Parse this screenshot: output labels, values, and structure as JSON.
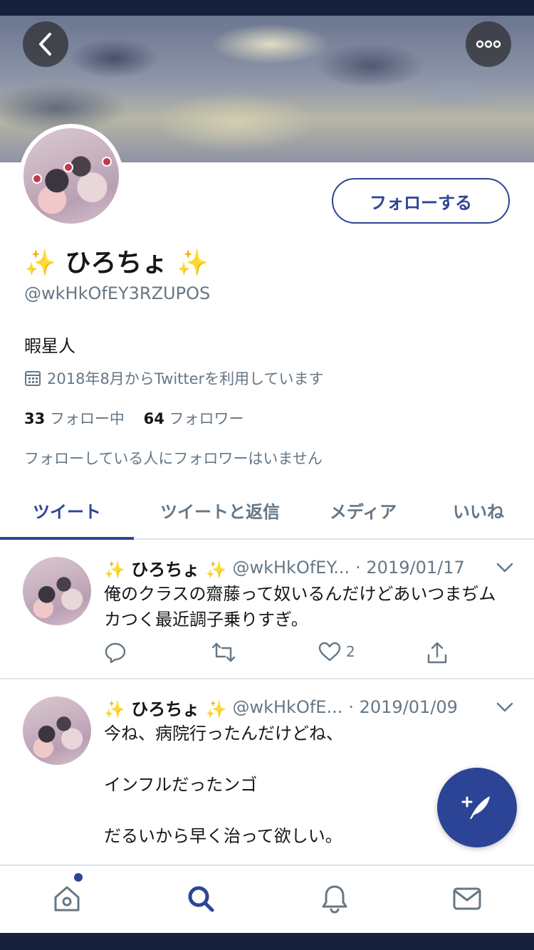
{
  "profile": {
    "display_name_sparkle_left": "✨",
    "display_name": "ひろちょ",
    "display_name_sparkle_right": "✨",
    "handle": "@wkHkOfEY3RZUPOS",
    "bio": "暇星人",
    "joined": "2018年8月からTwitterを利用しています",
    "following_count": "33",
    "following_label": "フォロー中",
    "followers_count": "64",
    "followers_label": "フォロワー",
    "no_mutual_text": "フォローしている人にフォロワーはいません",
    "follow_button_label": "フォローする"
  },
  "tabs": [
    {
      "label": "ツイート",
      "active": true
    },
    {
      "label": "ツイートと返信",
      "active": false
    },
    {
      "label": "メディア",
      "active": false
    },
    {
      "label": "いいね",
      "active": false
    }
  ],
  "tweets": [
    {
      "name": "✨ ひろちょ ✨",
      "handle": "@wkHkOfEY...",
      "date": "· 2019/01/17",
      "text": "俺のクラスの齋藤って奴いるんだけどあいつまぢムカつく最近調子乗りすぎ。",
      "like_count": "2"
    },
    {
      "name": "✨ ひろちょ ✨",
      "handle": "@wkHkOfE...",
      "date": "· 2019/01/09",
      "text": "今ね、病院行ったんだけどね、\n\nインフルだったンゴ\n\nだるいから早く治って欲しい。"
    }
  ],
  "icons": {
    "back": "chevron-left-icon",
    "more": "more-horizontal-icon",
    "calendar": "calendar-icon",
    "reply": "reply-icon",
    "retweet": "retweet-icon",
    "like": "heart-icon",
    "share": "share-icon",
    "compose": "compose-tweet-icon",
    "home": "home-icon",
    "search": "search-icon",
    "notifications": "bell-icon",
    "messages": "mail-icon"
  },
  "colors": {
    "accent": "#2c4496",
    "secondary_text": "#657786",
    "primary_text": "#14171a",
    "sparkle": "#f2c229",
    "frame": "#17203d"
  }
}
